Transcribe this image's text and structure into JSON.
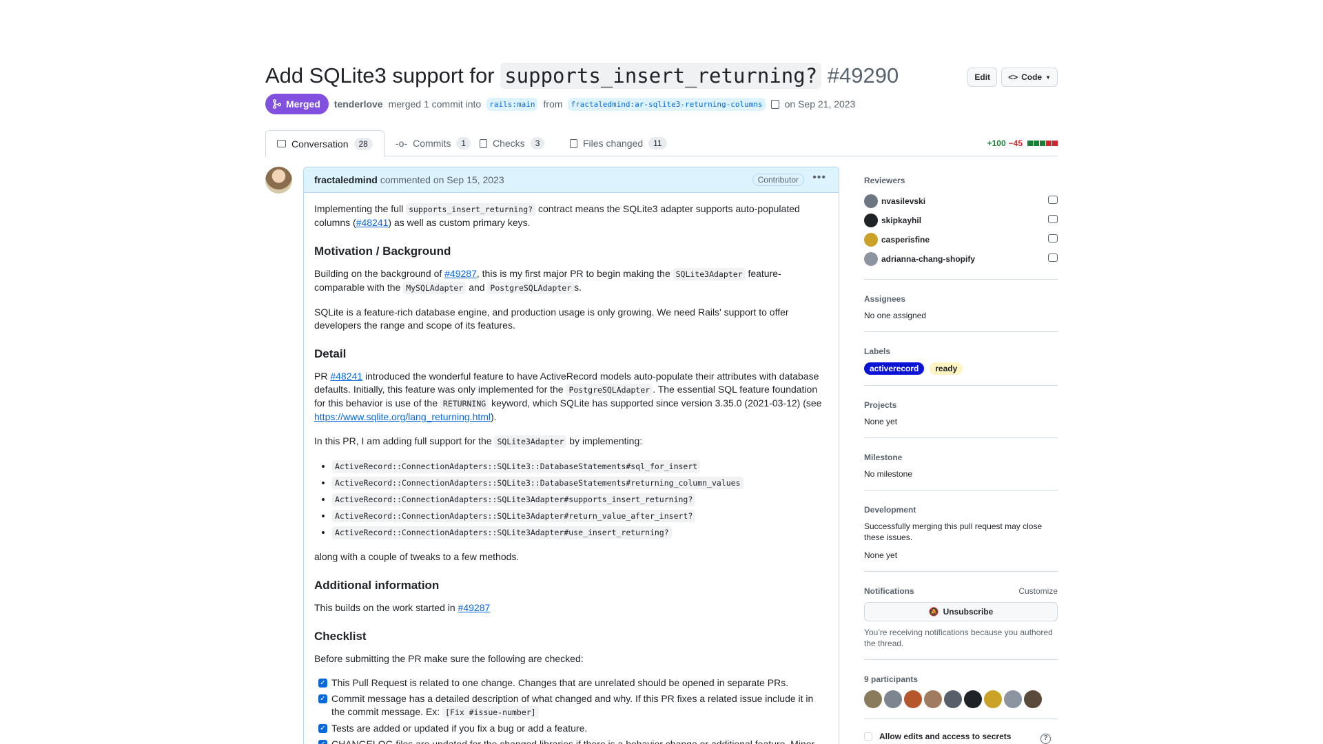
{
  "header": {
    "title_prefix": "Add SQLite3 support for",
    "title_code": "supports_insert_returning?",
    "number": "#49290",
    "edit_label": "Edit",
    "code_label": "Code"
  },
  "meta": {
    "state": "Merged",
    "author": "tenderlove",
    "text1": "merged 1 commit into",
    "base_branch": "rails:main",
    "text2": "from",
    "head_branch": "fractaledmind:ar-sqlite3-returning-columns",
    "date_text": "on Sep 21, 2023"
  },
  "tabs": [
    {
      "label": "Conversation",
      "count": "28"
    },
    {
      "label": "Commits",
      "count": "1"
    },
    {
      "label": "Checks",
      "count": "3"
    },
    {
      "label": "Files changed",
      "count": "11"
    }
  ],
  "diffstat": {
    "additions": "+100",
    "deletions": "−45",
    "colors": [
      "#1a7f37",
      "#1a7f37",
      "#1a7f37",
      "#d1242f",
      "#d1242f"
    ]
  },
  "comment": {
    "author": "fractaledmind",
    "action": "commented on Sep 15, 2023",
    "badge": "Contributor",
    "p1_a": "Implementing the full",
    "p1_code": "supports_insert_returning?",
    "p1_b": "contract means the SQLite3 adapter supports auto-populated columns (",
    "p1_link": "#48241",
    "p1_c": ") as well as custom primary keys.",
    "h_motivation": "Motivation / Background",
    "p2_a": "Building on the background of",
    "p2_link": "#49287",
    "p2_b": ", this is my first major PR to begin making the",
    "p2_code1": "SQLite3Adapter",
    "p2_c": "feature-comparable with the",
    "p2_code2": "MySQLAdapter",
    "p2_d": "and",
    "p2_code3": "PostgreSQLAdapter",
    "p2_e": "s.",
    "p3": "SQLite is a feature-rich database engine, and production usage is only growing. We need Rails' support to offer developers the range and scope of its features.",
    "h_detail": "Detail",
    "p4_a": "PR",
    "p4_link": "#48241",
    "p4_b": "introduced the wonderful feature to have ActiveRecord models auto-populate their attributes with database defaults. Initially, this feature was only implemented for the",
    "p4_code1": "PostgreSQLAdapter",
    "p4_c": ". The essential SQL feature foundation for this behavior is use of the",
    "p4_code2": "RETURNING",
    "p4_d": "keyword, which SQLite has supported since version 3.35.0 (2021-03-12) (see",
    "p4_link2": "https://www.sqlite.org/lang_returning.html",
    "p4_e": ").",
    "p5_a": "In this PR, I am adding full support for the",
    "p5_code": "SQLite3Adapter",
    "p5_b": "by implementing:",
    "methods": [
      "ActiveRecord::ConnectionAdapters::SQLite3::DatabaseStatements#sql_for_insert",
      "ActiveRecord::ConnectionAdapters::SQLite3::DatabaseStatements#returning_column_values",
      "ActiveRecord::ConnectionAdapters::SQLite3Adapter#supports_insert_returning?",
      "ActiveRecord::ConnectionAdapters::SQLite3Adapter#return_value_after_insert?",
      "ActiveRecord::ConnectionAdapters::SQLite3Adapter#use_insert_returning?"
    ],
    "p6": "along with a couple of tweaks to a few methods.",
    "h_additional": "Additional information",
    "p7_a": "This builds on the work started in",
    "p7_link": "#49287",
    "h_checklist": "Checklist",
    "p8": "Before submitting the PR make sure the following are checked:",
    "check1": "This Pull Request is related to one change. Changes that are unrelated should be opened in separate PRs.",
    "check2_a": "Commit message has a detailed description of what changed and why. If this PR fixes a related issue include it in the commit message. Ex:",
    "check2_code": "[Fix #issue-number]",
    "check3": "Tests are added or updated if you fix a bug or add a feature.",
    "check4": "CHANGELOG files are updated for the changed libraries if there is a behavior change or additional feature. Minor bug"
  },
  "sidebar": {
    "reviewers_title": "Reviewers",
    "reviewers": [
      {
        "name": "nvasilevski",
        "color": "#6e7781"
      },
      {
        "name": "skipkayhil",
        "color": "#1f2328"
      },
      {
        "name": "casperisfine",
        "color": "#c9a227"
      },
      {
        "name": "adrianna-chang-shopify",
        "color": "#8c959f"
      }
    ],
    "assignees_title": "Assignees",
    "assignees_value": "No one assigned",
    "labels_title": "Labels",
    "labels": [
      {
        "name": "activerecord",
        "bg": "#0b14d6",
        "fg": "#ffffff"
      },
      {
        "name": "ready",
        "bg": "#fff5c2",
        "fg": "#1f2328"
      }
    ],
    "projects_title": "Projects",
    "projects_value": "None yet",
    "milestone_title": "Milestone",
    "milestone_value": "No milestone",
    "development_title": "Development",
    "development_text": "Successfully merging this pull request may close these issues.",
    "development_value": "None yet",
    "notifications_title": "Notifications",
    "customize_label": "Customize",
    "unsubscribe_label": "Unsubscribe",
    "notifications_reason": "You’re receiving notifications because you authored the thread.",
    "participants_title": "9 participants",
    "participant_colors": [
      "#8a7b5c",
      "#7d8590",
      "#b5562c",
      "#a07b60",
      "#57606a",
      "#1f2328",
      "#c9a227",
      "#8c959f",
      "#5a4a3a"
    ],
    "allow_edits_label": "Allow edits and access to secrets by maintainers"
  }
}
